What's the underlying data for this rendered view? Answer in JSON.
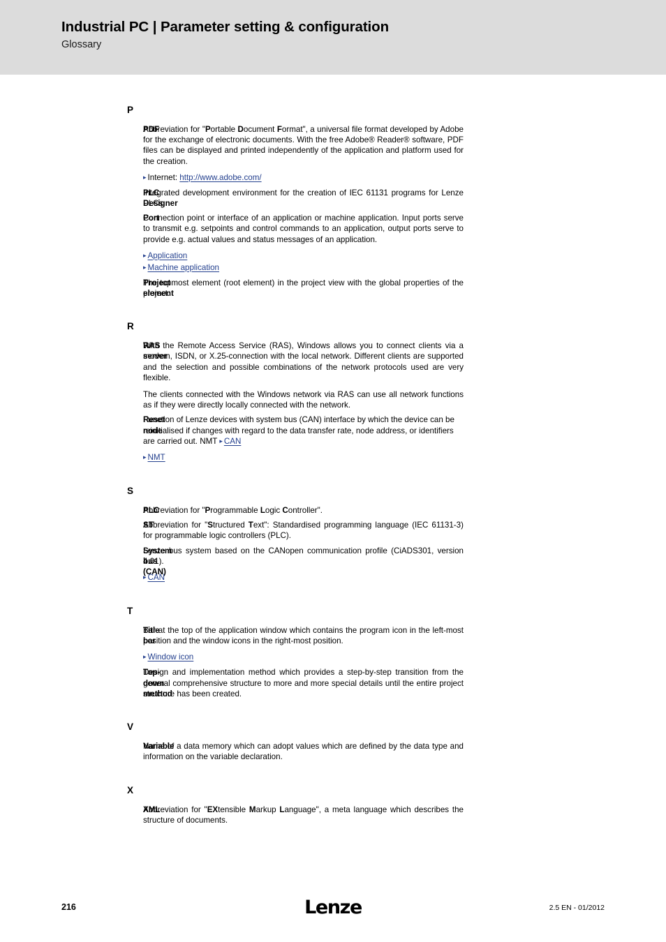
{
  "header": {
    "title": "Industrial PC | Parameter setting & configuration",
    "subtitle": "Glossary"
  },
  "footer": {
    "page_number": "216",
    "logo": "Lenze",
    "version": "2.5 EN - 01/2012"
  },
  "colors": {
    "header_band": "#dcdcdc",
    "link": "#24408E",
    "text": "#000000"
  },
  "glossary": [
    {
      "letter": "P",
      "entries": [
        {
          "term": "PDF",
          "paragraphs": [
            "Abbreviation for \"Portable Document Format\", a universal file format developed by Adobe for the exchange of electronic documents. With the free Adobe® Reader® software, PDF files can be displayed and printed independently of the application and platform used for the creation."
          ],
          "links": [
            {
              "prefix": "Internet: ",
              "label": "http://www.adobe.com/"
            }
          ]
        },
        {
          "term": "PLC Designer",
          "paragraphs": [
            "Integrated development environment for the creation of IEC 61131 programs for Lenze PLCs."
          ],
          "links": []
        },
        {
          "term": "Port",
          "paragraphs": [
            "Connection point or interface of an application or machine application. Input ports serve to transmit e.g. setpoints and control commands to an application, output ports serve to provide e.g. actual values and status messages of an application."
          ],
          "links": [
            {
              "prefix": "",
              "label": "Application"
            },
            {
              "prefix": "",
              "label": "Machine application"
            }
          ]
        },
        {
          "term": "Project element",
          "paragraphs": [
            "The topmost element (root element) in the project view with the global properties of the project."
          ],
          "links": []
        }
      ]
    },
    {
      "letter": "R",
      "entries": [
        {
          "term": "RAS server",
          "paragraphs": [
            "With the Remote Access Service (RAS), Windows allows you to connect clients via a modem, ISDN, or X.25-connection with the local network. Different clients are supported and the selection and possible combinations of the network protocols used are very flexible.",
            "The clients connected with the Windows network via RAS can use all network functions as if they were directly locally connected with the network."
          ],
          "links": []
        },
        {
          "term": "Reset node",
          "paragraphs": [
            "Function of Lenze devices with system bus (CAN) interface by which the device can be reinitialised if changes with regard to the data transfer rate, node address, or identifiers are carried out. NMT"
          ],
          "inline_link": "CAN",
          "links": [
            {
              "prefix": "",
              "label": "NMT"
            }
          ]
        }
      ]
    },
    {
      "letter": "S",
      "entries": [
        {
          "term": "PLC",
          "paragraphs": [
            "Abbreviation for \"Programmable Logic Controller\"."
          ],
          "links": []
        },
        {
          "term": "ST",
          "paragraphs": [
            "Abbreviation for \"Structured Text\": Standardised programming language (IEC 61131-3) for programmable logic controllers (PLC)."
          ],
          "links": []
        },
        {
          "term": "System bus (CAN)",
          "paragraphs": [
            "Lenze bus system based on the CANopen communication profile (CiADS301, version 4.01)."
          ],
          "links": [
            {
              "prefix": "",
              "label": "CAN"
            }
          ]
        }
      ]
    },
    {
      "letter": "T",
      "entries": [
        {
          "term": "Title bar",
          "paragraphs": [
            "Bar at the top of the application window which contains the program icon in the left-most position and the window icons in the right-most position."
          ],
          "links": [
            {
              "prefix": "",
              "label": "Window icon"
            }
          ]
        },
        {
          "term": "Top-down method",
          "paragraphs": [
            "Design and implementation method which provides a step-by-step transition from the general comprehensive structure to more and more special details until the entire project structure has been created."
          ],
          "links": []
        }
      ]
    },
    {
      "letter": "V",
      "entries": [
        {
          "term": "Variable",
          "paragraphs": [
            "Name of a data memory which can adopt values which are defined by the data type and information on the variable declaration."
          ],
          "links": []
        }
      ]
    },
    {
      "letter": "X",
      "entries": [
        {
          "term": "XML",
          "paragraphs": [
            "Abbreviation for \"EXtensible Markup Language\", a meta language which describes the structure of documents."
          ],
          "links": []
        }
      ]
    }
  ]
}
